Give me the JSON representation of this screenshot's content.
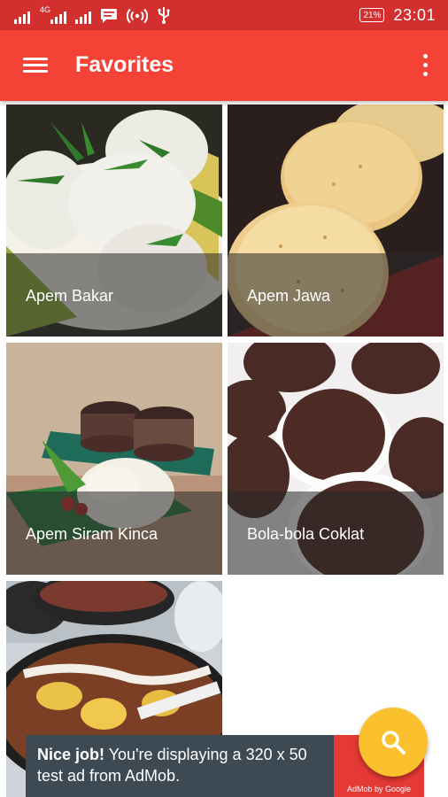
{
  "status_bar": {
    "network_label": "4G",
    "battery": "21%",
    "time": "23:01",
    "icons": [
      "signal-icon",
      "signal-4g-icon",
      "signal-icon",
      "chat-notification-icon",
      "hotspot-icon",
      "usb-icon",
      "battery-icon"
    ]
  },
  "app_bar": {
    "title": "Favorites",
    "menu_icon": "hamburger-menu-icon",
    "overflow_icon": "more-vert-icon",
    "colors": {
      "primary": "#f44336",
      "primary_dark": "#d32f2f"
    }
  },
  "favorites": [
    {
      "name": "Apem Bakar"
    },
    {
      "name": "Apem Jawa"
    },
    {
      "name": "Apem Siram Kinca"
    },
    {
      "name": "Bola-bola Coklat"
    },
    {
      "name": ""
    }
  ],
  "ad": {
    "headline": "Nice job!",
    "body": " You're displaying a 320 x 50 test ad from AdMob.",
    "logo_caption": "AdMob by Google",
    "background": "#3d4a54"
  },
  "fab": {
    "icon": "search-icon",
    "color": "#fbc02d"
  }
}
